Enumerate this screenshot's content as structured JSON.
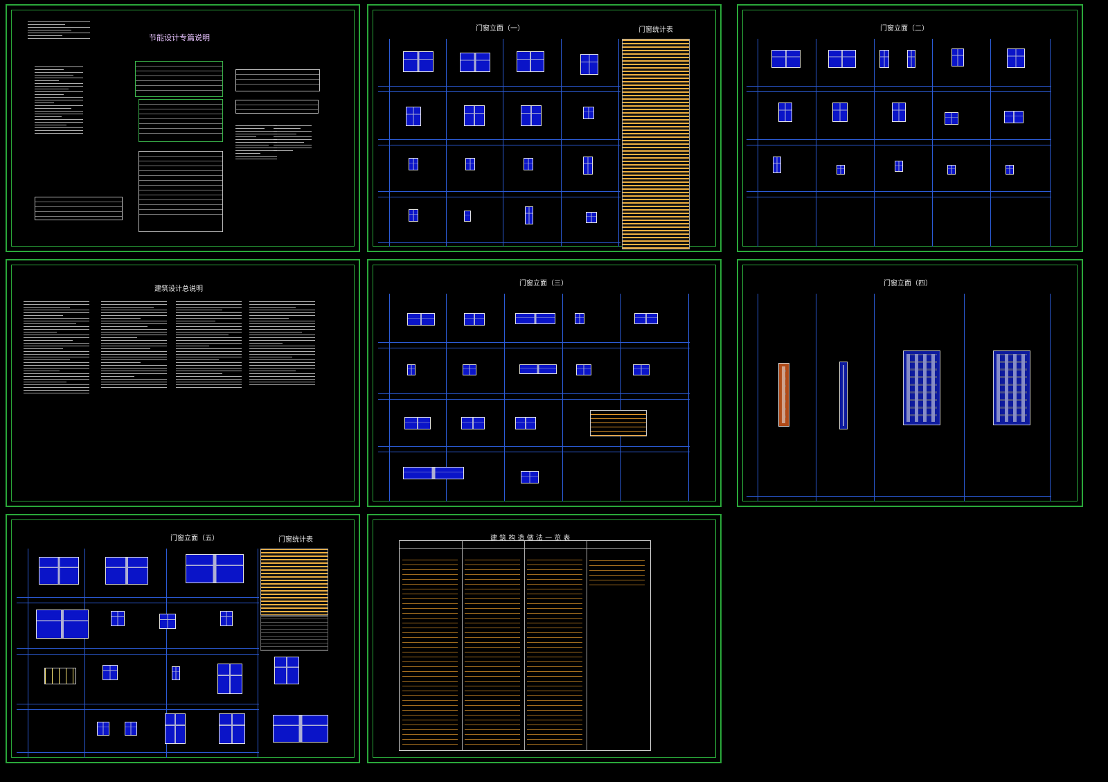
{
  "sheets": [
    {
      "id": "s1",
      "title": "节能设计专篇说明"
    },
    {
      "id": "s2",
      "title": "门窗立面（一）",
      "subtitle": "门窗统计表"
    },
    {
      "id": "s3",
      "title": "门窗立面（二）"
    },
    {
      "id": "s4",
      "title": "建筑设计总说明"
    },
    {
      "id": "s5",
      "title": "门窗立面（三）"
    },
    {
      "id": "s6",
      "title": "门窗立面（四）"
    },
    {
      "id": "s7",
      "title": "门窗立面（五）",
      "subtitle": "门窗统计表"
    },
    {
      "id": "s8",
      "title": "建 筑 构 造 做 法 一 览 表"
    }
  ],
  "colors": {
    "frame": "#2aa83a",
    "grid": "#2b5bd6",
    "glass": "#0a14c8",
    "table": "#f0b040"
  }
}
